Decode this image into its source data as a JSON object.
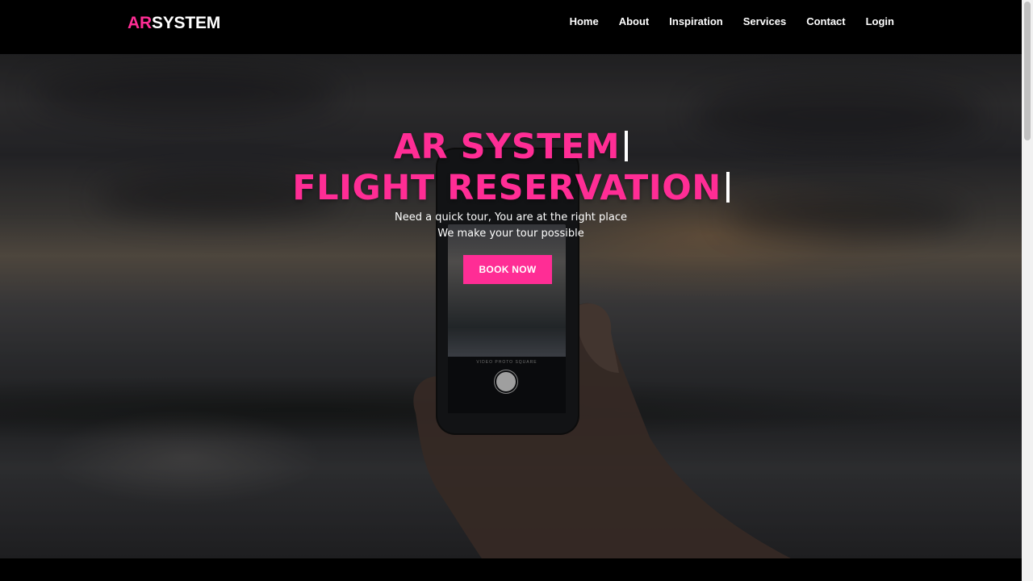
{
  "brand": {
    "accent": "AR",
    "rest": "SYSTEM",
    "accent_color": "#ff2d95"
  },
  "nav": {
    "items": [
      "Home",
      "About",
      "Inspiration",
      "Services",
      "Contact",
      "Login"
    ]
  },
  "hero": {
    "title_line1": "AR SYSTEM",
    "title_line2": "FLIGHT RESERVATION",
    "subtitle_line1": "Need a quick tour, You are at the right place",
    "subtitle_line2": "We make your tour possible",
    "cta_label": "BOOK NOW",
    "phone_mode_text": "VIDEO  PHOTO  SQUARE"
  },
  "colors": {
    "primary": "#ff2d95",
    "navbar": "#000000",
    "text": "#ffffff"
  }
}
